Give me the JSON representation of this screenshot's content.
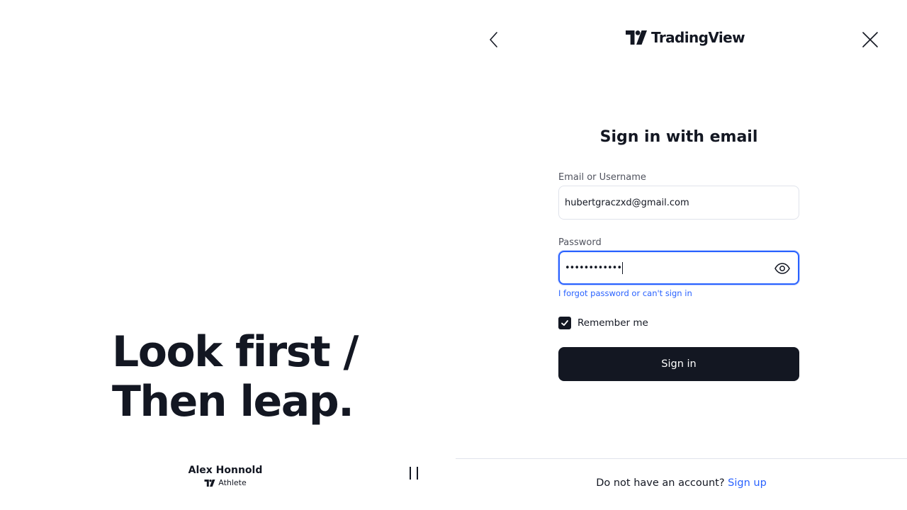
{
  "promo": {
    "headline_line1": "Look first /",
    "headline_line2": "Then leap.",
    "athlete_name": "Alex Honnold",
    "athlete_role": "Athlete",
    "icons": {
      "brand": "tradingview-logo-icon",
      "pause": "pause-icon"
    }
  },
  "header": {
    "brand_name": "TradingView",
    "icons": {
      "back": "chevron-left-icon",
      "close": "close-icon"
    }
  },
  "form": {
    "title": "Sign in with email",
    "email_label": "Email or Username",
    "email_value": "hubertgraczxd@gmail.com",
    "password_label": "Password",
    "password_masked": "••••••••••••",
    "password_icon": "eye-icon",
    "forgot_link": "I forgot password or can't sign in",
    "remember_label": "Remember me",
    "remember_checked": true,
    "submit_label": "Sign in"
  },
  "footer": {
    "prompt": "Do not have an account?",
    "signup_link": "Sign up"
  },
  "colors": {
    "text": "#131722",
    "accent": "#2962ff",
    "button_bg": "#131722",
    "border": "#e0e3eb"
  }
}
